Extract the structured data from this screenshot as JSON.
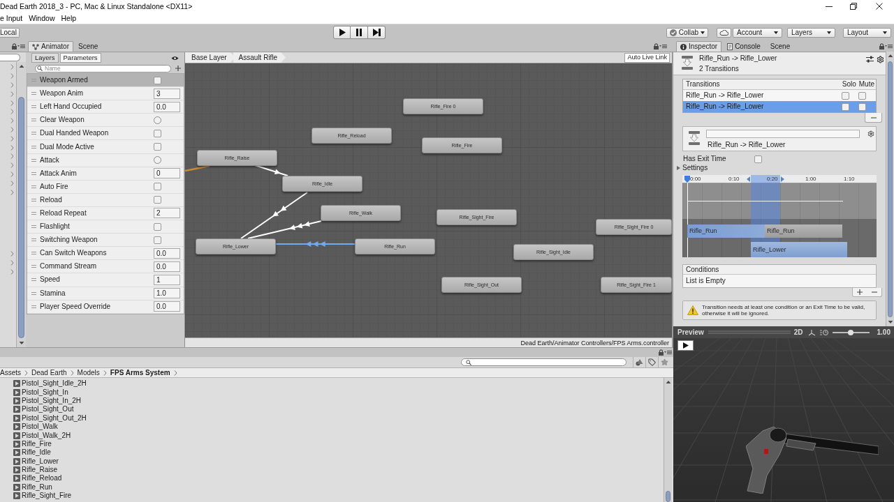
{
  "window": {
    "title": "Dead Earth 2018_3 - PC, Mac & Linux Standalone <DX11>"
  },
  "menu_bar": [
    "e Input",
    "Window",
    "Help"
  ],
  "toolbar": {
    "local": "Local",
    "collab": "Collab",
    "account": "Account",
    "layers": "Layers",
    "layout": "Layout"
  },
  "animator": {
    "tabs": [
      {
        "label": "Animator",
        "selected": true
      },
      {
        "label": "Scene",
        "selected": false
      }
    ],
    "panel_tabs": [
      {
        "label": "Layers",
        "selected": false
      },
      {
        "label": "Parameters",
        "selected": true
      }
    ],
    "search": {
      "placeholder": "Name"
    },
    "parameters": [
      {
        "name": "Weapon Armed",
        "kind": "bool",
        "checked": false,
        "selected": true
      },
      {
        "name": "Weapon Anim",
        "kind": "number",
        "value": "3",
        "selected": false
      },
      {
        "name": "Left Hand Occupied",
        "kind": "number",
        "value": "0.0",
        "selected": false
      },
      {
        "name": "Clear Weapon",
        "kind": "trigger",
        "checked": false,
        "selected": false
      },
      {
        "name": "Dual Handed Weapon",
        "kind": "bool",
        "checked": false,
        "selected": false
      },
      {
        "name": "Dual Mode Active",
        "kind": "bool",
        "checked": false,
        "selected": false
      },
      {
        "name": "Attack",
        "kind": "trigger",
        "checked": false,
        "selected": false
      },
      {
        "name": "Attack Anim",
        "kind": "number",
        "value": "0",
        "selected": false
      },
      {
        "name": "Auto Fire",
        "kind": "bool",
        "checked": false,
        "selected": false
      },
      {
        "name": "Reload",
        "kind": "bool",
        "checked": false,
        "selected": false
      },
      {
        "name": "Reload Repeat",
        "kind": "number",
        "value": "2",
        "selected": false
      },
      {
        "name": "Flashlight",
        "kind": "bool",
        "checked": false,
        "selected": false
      },
      {
        "name": "Switching Weapon",
        "kind": "bool",
        "checked": false,
        "selected": false
      },
      {
        "name": "Can Switch Weapons",
        "kind": "number",
        "value": "0.0",
        "selected": false
      },
      {
        "name": "Command Stream",
        "kind": "number",
        "value": "0.0",
        "selected": false
      },
      {
        "name": "Speed",
        "kind": "number",
        "value": "1",
        "selected": false
      },
      {
        "name": "Stamina",
        "kind": "number",
        "value": "1.0",
        "selected": false
      },
      {
        "name": "Player Speed Override",
        "kind": "number",
        "value": "0.0",
        "selected": false
      }
    ],
    "breadcrumbs": [
      "Base Layer",
      "Assault Rifle"
    ],
    "live_link": "Auto Live Link",
    "states": [
      "Rifle_Fire 0",
      "Rifle_Reload",
      "Rifle_Fire",
      "Rifle_Raise",
      "Rifle_Idle",
      "Rifle_Walk",
      "Rifle_Sight_Fire",
      "Rifle_Sight_Fire 0",
      "Rifle_Lower",
      "Rifle_Run",
      "Rifle_Sight_Idle",
      "Rifle_Sight_Out",
      "Rifle_Sight_Fire 1"
    ],
    "transitions": [
      {
        "selected": false
      },
      {
        "selected": false
      },
      {
        "selected": false
      },
      {
        "selected": true
      }
    ],
    "status_path": "Dead Earth/Animator Controllers/FPS Arms.controller"
  },
  "inspector": {
    "tabs": [
      {
        "label": "Inspector",
        "selected": true
      },
      {
        "label": "Console",
        "selected": false
      },
      {
        "label": "Scene",
        "selected": false
      }
    ],
    "title": "Rifle_Run -> Rifle_Lower",
    "subtitle": "2 Transitions",
    "transition_list": {
      "heading": "Transitions",
      "solo": "Solo",
      "mute": "Mute",
      "rows": [
        {
          "name": "Rifle_Run -> Rifle_Lower",
          "solo": false,
          "mute": false,
          "selected": false
        },
        {
          "name": "Rifle_Run -> Rifle_Lower",
          "solo": false,
          "mute": false,
          "selected": true
        }
      ]
    },
    "transition_name": "Rifle_Run -> Rifle_Lower",
    "has_exit_time": {
      "label": "Has Exit Time",
      "checked": false
    },
    "settings": {
      "label": "Settings",
      "expanded": false
    },
    "timeline": {
      "ticks": [
        "0:00",
        "0:10",
        "0:20",
        "1:00",
        "1:10"
      ],
      "clips": [
        {
          "name": "Rifle_Run",
          "kind": "source"
        },
        {
          "name": "Rifle_Run",
          "kind": "source_rest"
        },
        {
          "name": "Rifle_Lower",
          "kind": "destination"
        }
      ]
    },
    "conditions": {
      "heading": "Conditions",
      "empty_text": "List is Empty"
    },
    "warning": "Transition needs at least one condition or an Exit Time to be valid, otherwise it will be ignored."
  },
  "preview": {
    "title": "Preview",
    "mode": "2D",
    "speed": "1.00",
    "level": 0.5
  },
  "project": {
    "breadcrumbs": [
      "Assets",
      "Dead Earth",
      "Models",
      "FPS Arms System"
    ],
    "items": [
      "Pistol_Sight_Idle_2H",
      "Pistol_Sight_In",
      "Pistol_Sight_In_2H",
      "Pistol_Sight_Out",
      "Pistol_Sight_Out_2H",
      "Pistol_Walk",
      "Pistol_Walk_2H",
      "Rifle_Fire",
      "Rifle_Idle",
      "Rifle_Lower",
      "Rifle_Raise",
      "Rifle_Reload",
      "Rifle_Run",
      "Rifle_Sight_Fire"
    ]
  }
}
